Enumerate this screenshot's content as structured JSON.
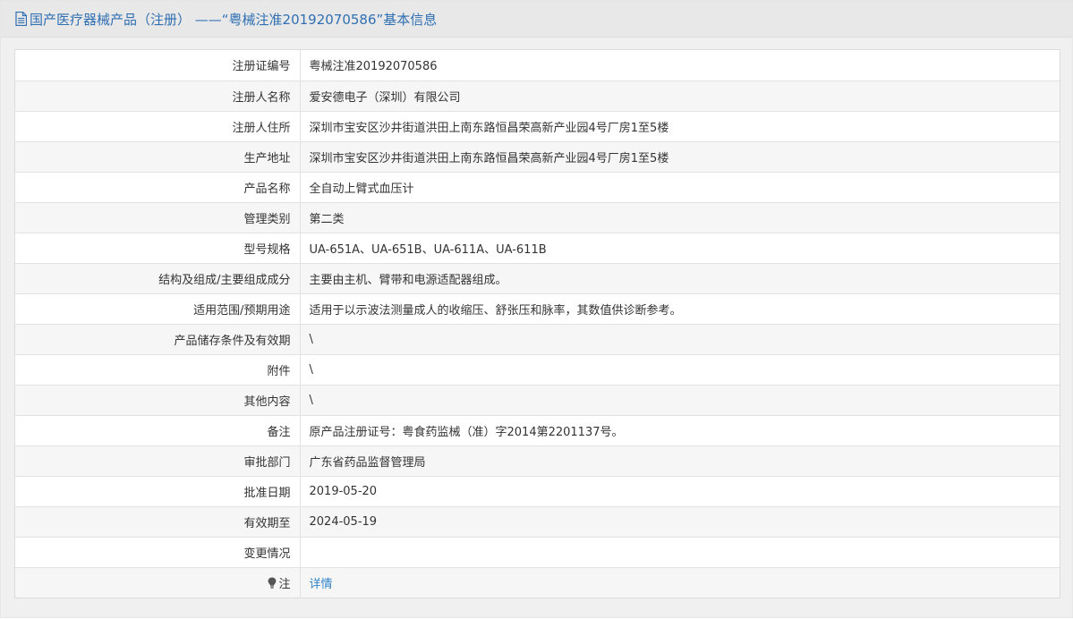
{
  "header": {
    "icon": "document-icon",
    "title": "国产医疗器械产品（注册） ——“粤械注准20192070586”基本信息",
    "title_color": "#2f6fb2"
  },
  "rows": [
    {
      "label": "注册证编号",
      "value": "粤械注准20192070586"
    },
    {
      "label": "注册人名称",
      "value": "爱安德电子（深圳）有限公司"
    },
    {
      "label": "注册人住所",
      "value": "深圳市宝安区沙井街道洪田上南东路恒昌荣高新产业园4号厂房1至5楼"
    },
    {
      "label": "生产地址",
      "value": "深圳市宝安区沙井街道洪田上南东路恒昌荣高新产业园4号厂房1至5楼"
    },
    {
      "label": "产品名称",
      "value": "全自动上臂式血压计"
    },
    {
      "label": "管理类别",
      "value": "第二类"
    },
    {
      "label": "型号规格",
      "value": "UA-651A、UA-651B、UA-611A、UA-611B"
    },
    {
      "label": "结构及组成/主要组成成分",
      "value": "主要由主机、臂带和电源适配器组成。"
    },
    {
      "label": "适用范围/预期用途",
      "value": "适用于以示波法测量成人的收缩压、舒张压和脉率，其数值供诊断参考。"
    },
    {
      "label": "产品储存条件及有效期",
      "value": "\\"
    },
    {
      "label": "附件",
      "value": "\\"
    },
    {
      "label": "其他内容",
      "value": "\\"
    },
    {
      "label": "备注",
      "value": "原产品注册证号：粤食药监械（准）字2014第2201137号。"
    },
    {
      "label": "审批部门",
      "value": "广东省药品监督管理局"
    },
    {
      "label": "批准日期",
      "value": "2019-05-20"
    },
    {
      "label": "有效期至",
      "value": "2024-05-19"
    },
    {
      "label": "变更情况",
      "value": ""
    }
  ],
  "note_row": {
    "icon": "lightbulb-icon",
    "label": "注",
    "link_text": "详情",
    "link_color": "#2f82c8"
  }
}
